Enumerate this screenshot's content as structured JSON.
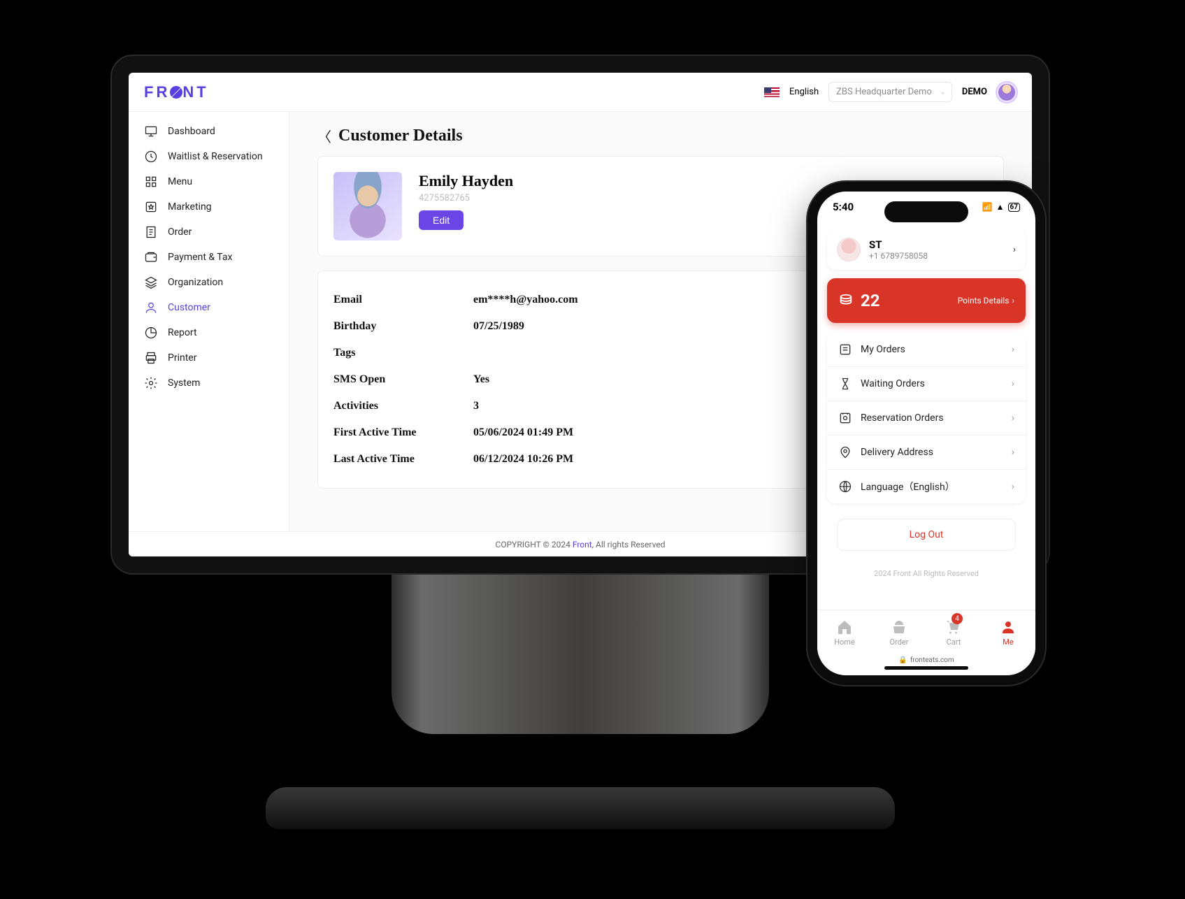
{
  "desktop": {
    "logo": "FRONT",
    "header": {
      "language": "English",
      "location": "ZBS Headquarter Demo",
      "account_label": "DEMO"
    },
    "sidebar": {
      "items": [
        {
          "label": "Dashboard",
          "icon": "monitor-icon"
        },
        {
          "label": "Waitlist & Reservation",
          "icon": "clock-icon"
        },
        {
          "label": "Menu",
          "icon": "grid-icon"
        },
        {
          "label": "Marketing",
          "icon": "star-badge-icon"
        },
        {
          "label": "Order",
          "icon": "receipt-icon"
        },
        {
          "label": "Payment & Tax",
          "icon": "wallet-icon"
        },
        {
          "label": "Organization",
          "icon": "layers-icon"
        },
        {
          "label": "Customer",
          "icon": "person-icon",
          "active": true
        },
        {
          "label": "Report",
          "icon": "piechart-icon"
        },
        {
          "label": "Printer",
          "icon": "printer-icon"
        },
        {
          "label": "System",
          "icon": "gear-icon"
        }
      ]
    },
    "page": {
      "title": "Customer Details",
      "customer": {
        "name": "Emily Hayden",
        "id": "4275582765",
        "edit_label": "Edit",
        "fields": [
          {
            "label": "Email",
            "value": "em****h@yahoo.com"
          },
          {
            "label": "Birthday",
            "value": "07/25/1989"
          },
          {
            "label": "Tags",
            "value": ""
          },
          {
            "label": "SMS Open",
            "value": "Yes"
          },
          {
            "label": "Activities",
            "value": "3"
          },
          {
            "label": "First Active Time",
            "value": "05/06/2024 01:49 PM"
          },
          {
            "label": "Last Active Time",
            "value": "06/12/2024 10:26 PM"
          }
        ]
      }
    },
    "footer": {
      "prefix": "COPYRIGHT © 2024  ",
      "link": "Front",
      "suffix": ", All rights Reserved"
    }
  },
  "phone": {
    "status_time": "5:40",
    "battery": "67",
    "profile": {
      "name": "ST",
      "phone": "+1 6789758058"
    },
    "points": {
      "value": "22",
      "details_label": "Points Details"
    },
    "menu": [
      {
        "label": "My Orders"
      },
      {
        "label": "Waiting Orders"
      },
      {
        "label": "Reservation Orders"
      },
      {
        "label": "Delivery Address"
      },
      {
        "label": "Language（English）"
      }
    ],
    "logout_label": "Log Out",
    "copyright": "2024 Front All Rights Reserved",
    "tabs": [
      {
        "label": "Home"
      },
      {
        "label": "Order"
      },
      {
        "label": "Cart",
        "badge": "4"
      },
      {
        "label": "Me",
        "active": true
      }
    ],
    "url": "fronteats.com"
  }
}
